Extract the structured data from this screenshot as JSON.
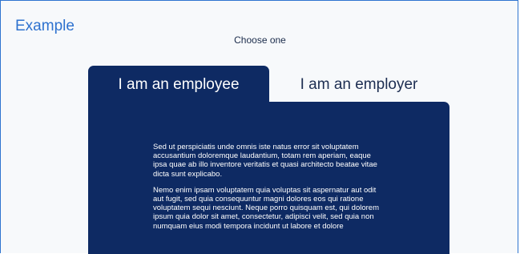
{
  "header": {
    "title": "Example",
    "prompt": "Choose one"
  },
  "tabs": [
    {
      "label": "I am an employee",
      "selected": true
    },
    {
      "label": "I am an employer",
      "selected": false
    }
  ],
  "panel": {
    "paragraphs": [
      "Sed ut perspiciatis unde omnis iste natus error sit voluptatem accusantium doloremque laudantium, totam rem aperiam, eaque ipsa quae ab illo inventore veritatis et quasi architecto beatae vitae dicta sunt explicabo.",
      "Nemo enim ipsam voluptatem quia voluptas sit aspernatur aut odit aut fugit, sed quia consequuntur magni dolores eos qui ratione voluptatem sequi nesciunt. Neque porro quisquam est, qui dolorem ipsum quia dolor sit amet, consectetur, adipisci velit, sed quia non numquam eius modi tempora incidunt ut labore et dolore"
    ]
  },
  "colors": {
    "accent": "#2e72cf",
    "panel": "#0e2a63",
    "page_background": "#f7f9fb"
  }
}
